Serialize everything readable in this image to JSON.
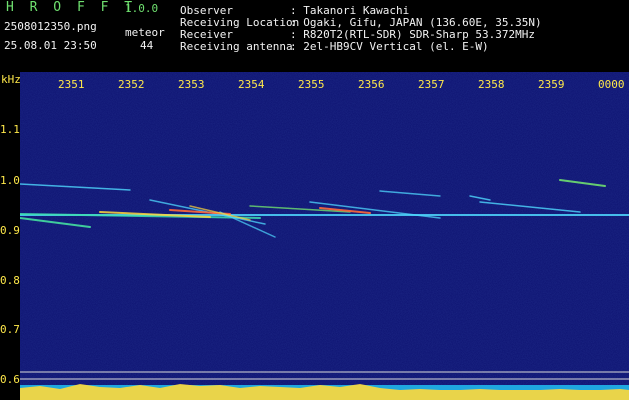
{
  "header": {
    "app_title": "H R O F F T",
    "version": "1.0.0",
    "filename": "2508012350.png",
    "meteor_label": "meteor",
    "datetime": "25.08.01 23:50",
    "meteor_count": "44",
    "info": [
      {
        "label": "Observer",
        "value": ": Takanori Kawachi"
      },
      {
        "label": "Receiving Location",
        "value": ": Ogaki, Gifu, JAPAN (136.60E, 35.35N)"
      },
      {
        "label": "Receiver",
        "value": ": R820T2(RTL-SDR) SDR-Sharp 53.372MHz"
      },
      {
        "label": "Receiving antenna",
        "value": ": 2el-HB9CV Vertical (el. E-W)"
      }
    ]
  },
  "axis": {
    "unit": "kHz",
    "x_ticks": [
      "2351",
      "2352",
      "2353",
      "2354",
      "2355",
      "2356",
      "2357",
      "2358",
      "2359",
      "0000"
    ],
    "y_ticks": [
      "1.1",
      "1.0",
      "0.9",
      "0.8",
      "0.7",
      "0.6"
    ]
  },
  "colors": {
    "background": "#0b0f6e",
    "label_green": "#6fe06f",
    "text_white": "#f2f2f2",
    "tick_yellow": "#ffe94a",
    "signal_cyan": "#4fd9ff",
    "signal_yellow": "#ffd83a"
  }
}
